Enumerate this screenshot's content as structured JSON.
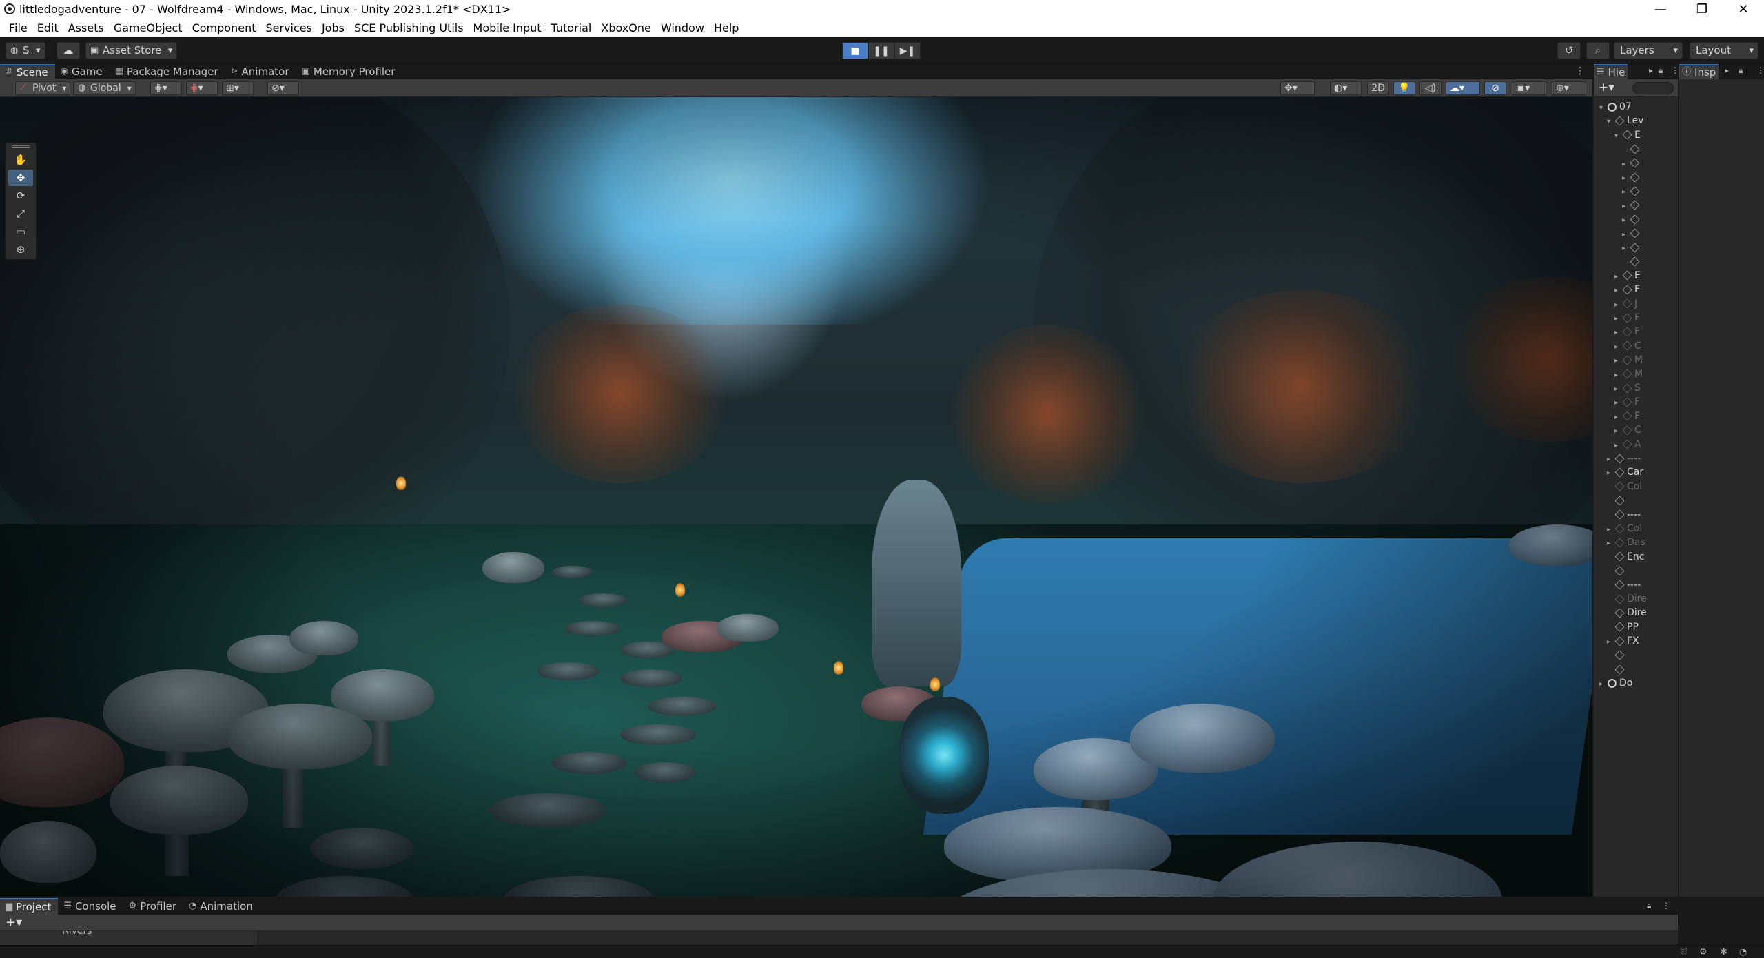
{
  "window": {
    "title": "littledogadventure - 07 - Wolfdream4 - Windows, Mac, Linux - Unity 2023.1.2f1* <DX11>",
    "minimize": "—",
    "maximize": "❐",
    "close": "✕"
  },
  "menu": {
    "items": [
      "File",
      "Edit",
      "Assets",
      "GameObject",
      "Component",
      "Services",
      "Jobs",
      "SCE Publishing Utils",
      "Mobile Input",
      "Tutorial",
      "XboxOne",
      "Window",
      "Help"
    ]
  },
  "main_toolbar": {
    "account_label": "S",
    "asset_store_label": "Asset Store",
    "play_buttons": [
      "■",
      "❚❚",
      "▶❚"
    ],
    "layers_label": "Layers",
    "layout_label": "Layout",
    "history_icon": "history-icon",
    "search_icon": "search-icon"
  },
  "scene_tabs": [
    {
      "label": "Scene",
      "icon": "#",
      "active": true
    },
    {
      "label": "Game",
      "icon": "◉",
      "active": false
    },
    {
      "label": "Package Manager",
      "icon": "▦",
      "active": false
    },
    {
      "label": "Animator",
      "icon": "⋗",
      "active": false
    },
    {
      "label": "Memory Profiler",
      "icon": "▣",
      "active": false
    }
  ],
  "scene_toolbar": {
    "pivot_label": "Pivot",
    "global_label": "Global",
    "mode_2d_label": "2D"
  },
  "tools": [
    "hand-tool",
    "move-tool",
    "rotate-tool",
    "scale-tool",
    "rect-tool",
    "transform-tool"
  ],
  "tool_glyphs": [
    "✋",
    "✥",
    "⟳",
    "⤢",
    "▭",
    "⊕"
  ],
  "hierarchy": {
    "tab_label": "Hie",
    "rows": [
      {
        "label": "07",
        "indent": 0,
        "fold": "▾",
        "icon": "scene",
        "dim": false
      },
      {
        "label": "Lev",
        "indent": 1,
        "fold": "▾",
        "icon": "cube",
        "dim": false
      },
      {
        "label": "E",
        "indent": 2,
        "fold": "▾",
        "icon": "cube",
        "dim": false
      },
      {
        "label": "",
        "indent": 3,
        "fold": "",
        "icon": "cube",
        "dim": false
      },
      {
        "label": "",
        "indent": 3,
        "fold": "▸",
        "icon": "cube",
        "dim": false
      },
      {
        "label": "",
        "indent": 3,
        "fold": "▸",
        "icon": "cube",
        "dim": false
      },
      {
        "label": "",
        "indent": 3,
        "fold": "▸",
        "icon": "cube",
        "dim": false
      },
      {
        "label": "",
        "indent": 3,
        "fold": "▸",
        "icon": "cube",
        "dim": false
      },
      {
        "label": "",
        "indent": 3,
        "fold": "▸",
        "icon": "cube",
        "dim": false
      },
      {
        "label": "",
        "indent": 3,
        "fold": "▸",
        "icon": "cube",
        "dim": false
      },
      {
        "label": "",
        "indent": 3,
        "fold": "▸",
        "icon": "cube",
        "dim": false
      },
      {
        "label": "",
        "indent": 3,
        "fold": "",
        "icon": "cube",
        "dim": false
      },
      {
        "label": "E",
        "indent": 2,
        "fold": "▸",
        "icon": "cube",
        "dim": false
      },
      {
        "label": "F",
        "indent": 2,
        "fold": "▸",
        "icon": "cube",
        "dim": false
      },
      {
        "label": "J",
        "indent": 2,
        "fold": "▸",
        "icon": "cube",
        "dim": true
      },
      {
        "label": "F",
        "indent": 2,
        "fold": "▸",
        "icon": "cube",
        "dim": true
      },
      {
        "label": "F",
        "indent": 2,
        "fold": "▸",
        "icon": "cube",
        "dim": true
      },
      {
        "label": "C",
        "indent": 2,
        "fold": "▸",
        "icon": "cube",
        "dim": true
      },
      {
        "label": "M",
        "indent": 2,
        "fold": "▸",
        "icon": "cube",
        "dim": true
      },
      {
        "label": "M",
        "indent": 2,
        "fold": "▸",
        "icon": "cube",
        "dim": true
      },
      {
        "label": "S",
        "indent": 2,
        "fold": "▸",
        "icon": "cube",
        "dim": true
      },
      {
        "label": "F",
        "indent": 2,
        "fold": "▸",
        "icon": "cube",
        "dim": true
      },
      {
        "label": "F",
        "indent": 2,
        "fold": "▸",
        "icon": "cube",
        "dim": true
      },
      {
        "label": "C",
        "indent": 2,
        "fold": "▸",
        "icon": "cube",
        "dim": true
      },
      {
        "label": "A",
        "indent": 2,
        "fold": "▸",
        "icon": "cube",
        "dim": true
      },
      {
        "label": "----",
        "indent": 1,
        "fold": "▸",
        "icon": "cube",
        "dim": false
      },
      {
        "label": "Car",
        "indent": 1,
        "fold": "▸",
        "icon": "cube",
        "dim": false
      },
      {
        "label": "Col",
        "indent": 1,
        "fold": "",
        "icon": "cube",
        "dim": true
      },
      {
        "label": "",
        "indent": 1,
        "fold": "",
        "icon": "cube",
        "dim": false
      },
      {
        "label": "----",
        "indent": 1,
        "fold": "",
        "icon": "cube",
        "dim": false
      },
      {
        "label": "Col",
        "indent": 1,
        "fold": "▸",
        "icon": "cube",
        "dim": true
      },
      {
        "label": "Das",
        "indent": 1,
        "fold": "▸",
        "icon": "cube",
        "dim": true
      },
      {
        "label": "Enc",
        "indent": 1,
        "fold": "",
        "icon": "cube",
        "dim": false
      },
      {
        "label": "",
        "indent": 1,
        "fold": "",
        "icon": "cube",
        "dim": false
      },
      {
        "label": "----",
        "indent": 1,
        "fold": "",
        "icon": "cube",
        "dim": false
      },
      {
        "label": "Dire",
        "indent": 1,
        "fold": "",
        "icon": "cube",
        "dim": true
      },
      {
        "label": "Dire",
        "indent": 1,
        "fold": "",
        "icon": "cube",
        "dim": false
      },
      {
        "label": "PP",
        "indent": 1,
        "fold": "",
        "icon": "cube",
        "dim": false
      },
      {
        "label": "FX",
        "indent": 1,
        "fold": "▸",
        "icon": "cube",
        "dim": false
      },
      {
        "label": "",
        "indent": 1,
        "fold": "",
        "icon": "cube",
        "dim": false
      },
      {
        "label": "",
        "indent": 1,
        "fold": "",
        "icon": "cube",
        "dim": false
      },
      {
        "label": "Do",
        "indent": 0,
        "fold": "▸",
        "icon": "scene",
        "dim": false
      }
    ]
  },
  "inspector": {
    "tab_label": "Insp"
  },
  "bottom_tabs": [
    {
      "label": "Project",
      "icon": "▆",
      "active": true
    },
    {
      "label": "Console",
      "icon": "☰",
      "active": false
    },
    {
      "label": "Profiler",
      "icon": "⚙",
      "active": false
    },
    {
      "label": "Animation",
      "icon": "◔",
      "active": false
    }
  ],
  "project": {
    "tree_item": "Rivers"
  },
  "colors": {
    "accent_blue": "#3a79bb",
    "active_tool": "#46607f",
    "panel_bg": "#282828",
    "toolbar_bg": "#191919"
  }
}
